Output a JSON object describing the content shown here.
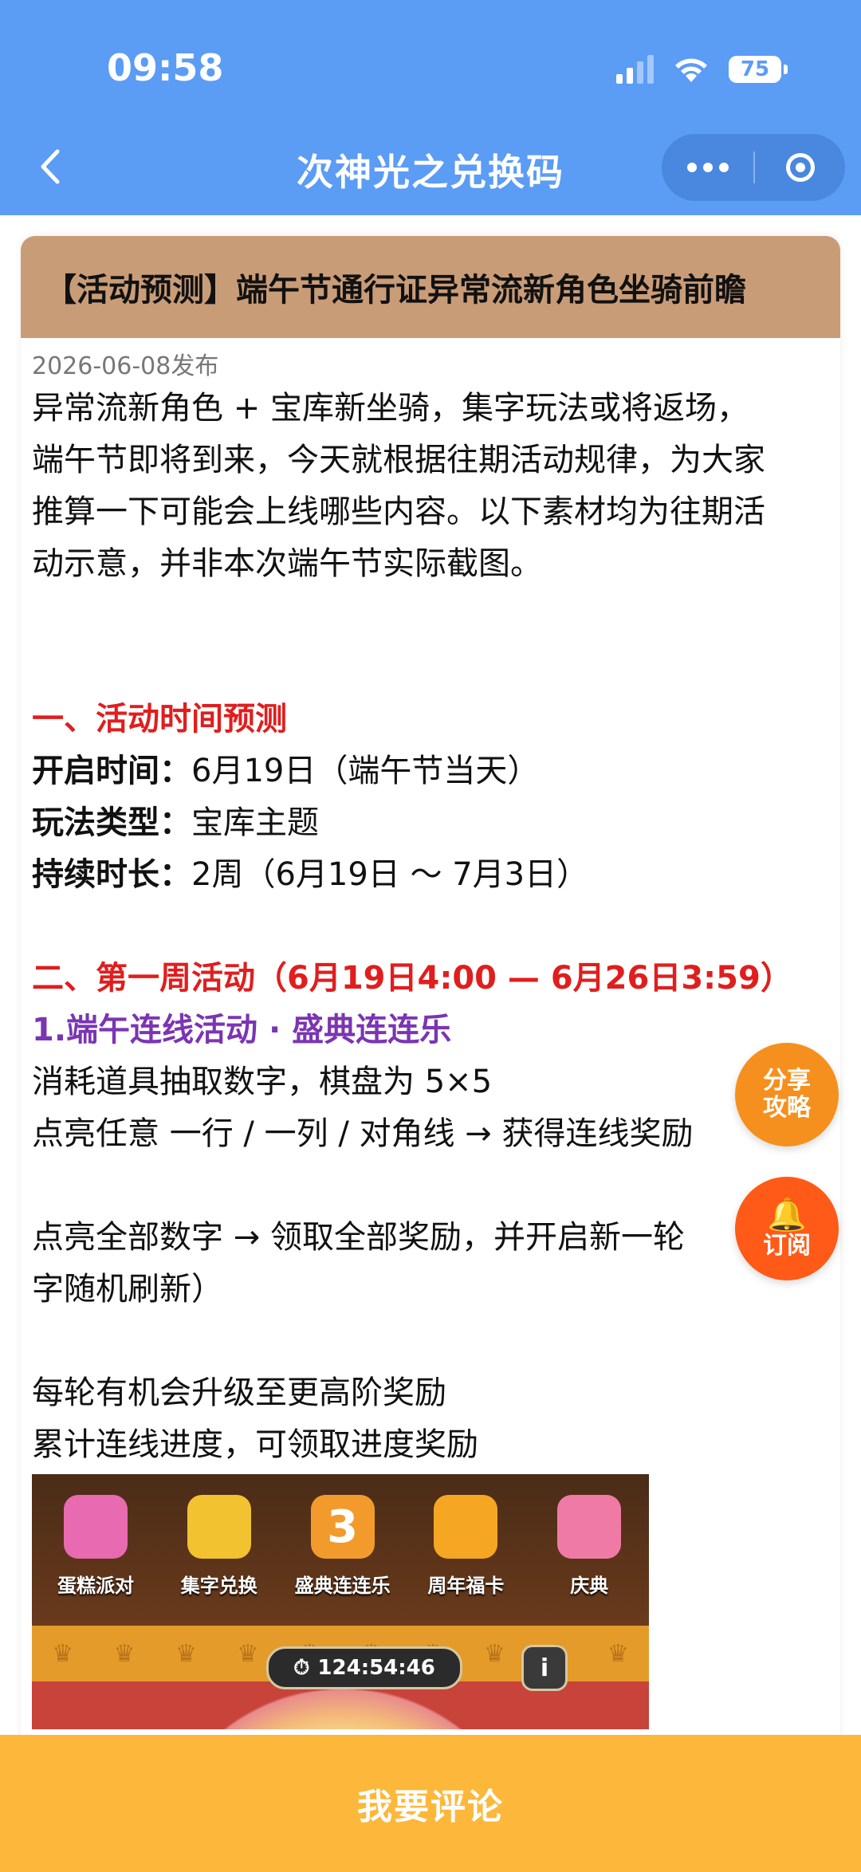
{
  "status": {
    "time": "09:58",
    "battery": "75"
  },
  "nav": {
    "title": "次神光之兑换码"
  },
  "article": {
    "title": "【活动预测】端午节通行证异常流新角色坐骑前瞻",
    "date": "2026-06-08发布",
    "intro": [
      "异常流新角色 + 宝库新坐骑，集字玩法或将返场，",
      "端午节即将到来，今天就根据往期活动规律，为大家",
      "推算一下可能会上线哪些内容。以下素材均为往期活",
      "动示意，并非本次端午节实际截图。"
    ],
    "section1": {
      "heading": "一、活动时间预测",
      "rows": [
        {
          "label": "开启时间：",
          "value": "6月19日（端午节当天）"
        },
        {
          "label": "玩法类型：",
          "value": "宝库主题"
        },
        {
          "label": "持续时长：",
          "value": "2周（6月19日 ～ 7月3日）"
        }
      ]
    },
    "section2": {
      "heading": "二、第一周活动（6月19日4:00 — 6月26日3:59）",
      "sub": "1.端午连线活动 · 盛典连连乐",
      "line1": "消耗道具抽取数字，棋盘为 5×5",
      "line2": "点亮任意 一行 / 一列 / 对角线 → 获得连线奖励",
      "line3": "点亮全部数字 → 领取全部奖励，并开启新一轮",
      "line4": "字随机刷新）",
      "line5": "每轮有机会升级至更高阶奖励",
      "line6": "累计连线进度，可领取进度奖励"
    },
    "game_image": {
      "tabs": [
        "蛋糕派对",
        "集字兑换",
        "盛典连连乐",
        "周年福卡",
        "庆典"
      ],
      "badge": "3",
      "timer": "124:54:46",
      "info": "i"
    }
  },
  "fab": {
    "share_line1": "分享",
    "share_line2": "攻略",
    "subscribe": "订阅"
  },
  "bottom": {
    "comment": "我要评论"
  }
}
